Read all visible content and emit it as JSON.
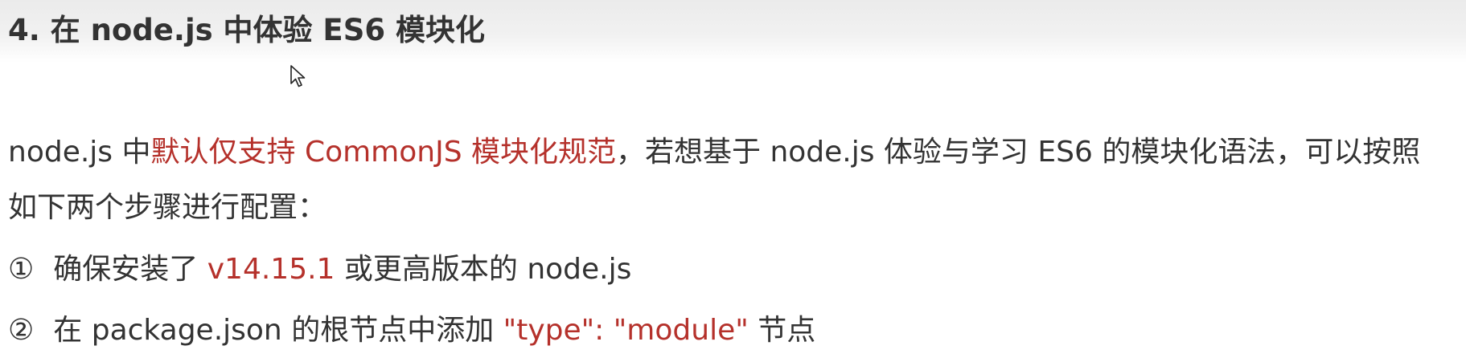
{
  "heading": "4. 在 node.js 中体验 ES6 模块化",
  "paragraph": {
    "line1_a": "node.js 中",
    "line1_highlight": "默认仅支持 CommonJS 模块化规范",
    "line1_b": "，若想基于 node.js 体验与学习 ES6 的模块化语法，可以按照",
    "line2": "如下两个步骤进行配置："
  },
  "steps": [
    {
      "marker": "①",
      "text_a": "确保安装了 ",
      "highlight": "v14.15.1",
      "text_b": " 或更高版本的 node.js"
    },
    {
      "marker": "②",
      "text_a": "在 package.json 的根节点中添加 ",
      "highlight": "\"type\": \"module\"",
      "text_b": " 节点"
    }
  ],
  "colors": {
    "highlight": "#b5312b",
    "text": "#333333",
    "header_band": "#ededed"
  },
  "icons": {
    "cursor": "mouse-pointer-icon"
  }
}
